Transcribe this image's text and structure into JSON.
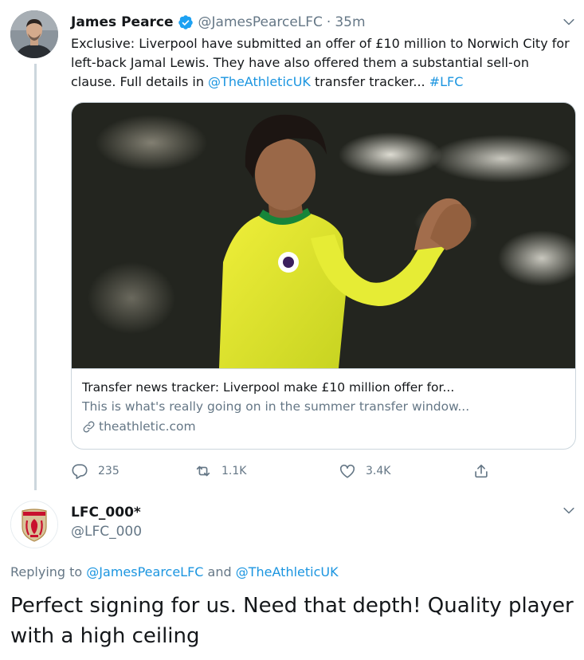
{
  "tweet": {
    "author_name": "James Pearce",
    "author_handle": "@JamesPearceLFC",
    "separator": "·",
    "time": "35m",
    "text_part1": "Exclusive: Liverpool have submitted an offer of £10 million to Norwich City for left-back Jamal Lewis. They have also offered them a substantial sell-on clause. Full details in ",
    "mention": "@TheAthleticUK",
    "text_part2": " transfer tracker... ",
    "hashtag": "#LFC",
    "card": {
      "title": "Transfer news tracker: Liverpool make £10 million offer for...",
      "description": "This is what's really going on in the summer transfer window...",
      "domain": "theathletic.com"
    },
    "actions": {
      "replies": "235",
      "retweets": "1.1K",
      "likes": "3.4K"
    }
  },
  "reply": {
    "author_name": "LFC_000*",
    "author_handle": "@LFC_000",
    "replying_prefix": "Replying to ",
    "replying_user1": "@JamesPearceLFC",
    "replying_and": " and ",
    "replying_user2": "@TheAthleticUK",
    "text": "Perfect signing for us. Need that depth! Quality player with a high ceiling"
  },
  "icons": {
    "verified": "verified-badge-icon",
    "menu": "chevron-down-icon",
    "link": "link-icon",
    "reply": "reply-icon",
    "retweet": "retweet-icon",
    "like": "heart-icon",
    "share": "share-icon"
  },
  "colors": {
    "link_blue": "#1b95e0",
    "text": "#14171a",
    "muted": "#657786",
    "border": "#ccd6dd"
  }
}
